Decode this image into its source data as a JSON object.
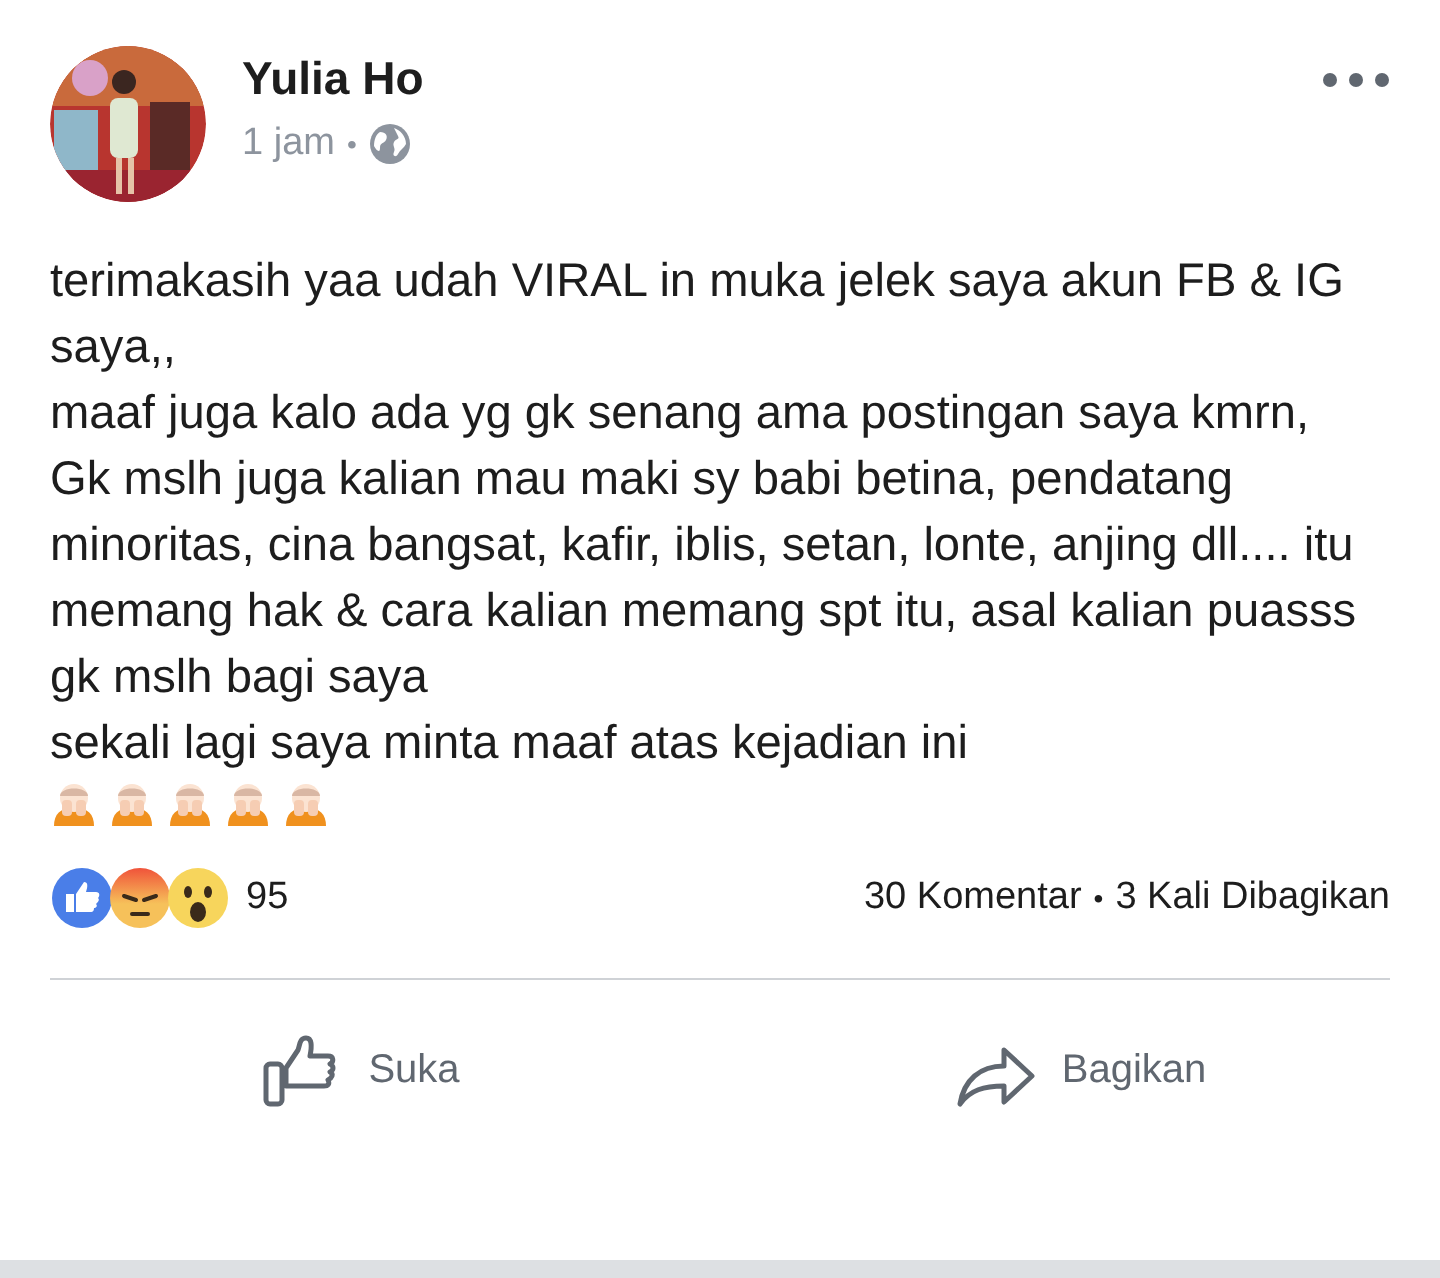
{
  "post": {
    "author": "Yulia Ho",
    "time": "1 jam",
    "separator": "•",
    "paragraphs": [
      "terimakasih yaa udah VIRAL in muka jelek saya akun FB & IG saya,,",
      "maaf juga kalo ada yg gk senang ama postingan saya kmrn,",
      "Gk mslh juga kalian mau maki sy babi betina, pendatang minoritas, cina bangsat, kafir, iblis, setan, lonte, anjing dll.... itu memang hak & cara kalian memang spt itu, asal kalian puasss gk mslh bagi saya",
      "sekali lagi saya minta maaf atas kejadian ini"
    ],
    "emojis": [
      {
        "kind": "covering-face"
      },
      {
        "kind": "covering-face"
      },
      {
        "kind": "covering-face"
      },
      {
        "kind": "covering-face"
      },
      {
        "kind": "covering-face"
      }
    ],
    "reactions": [
      {
        "kind": "like"
      },
      {
        "kind": "angry"
      },
      {
        "kind": "wow"
      }
    ],
    "reaction_count": "95",
    "comments": "30 Komentar",
    "stats_separator": "•",
    "shares": "3 Kali Dibagikan",
    "actions": [
      {
        "kind": "like",
        "label": "Suka"
      },
      {
        "kind": "share",
        "label": "Bagikan"
      }
    ]
  }
}
